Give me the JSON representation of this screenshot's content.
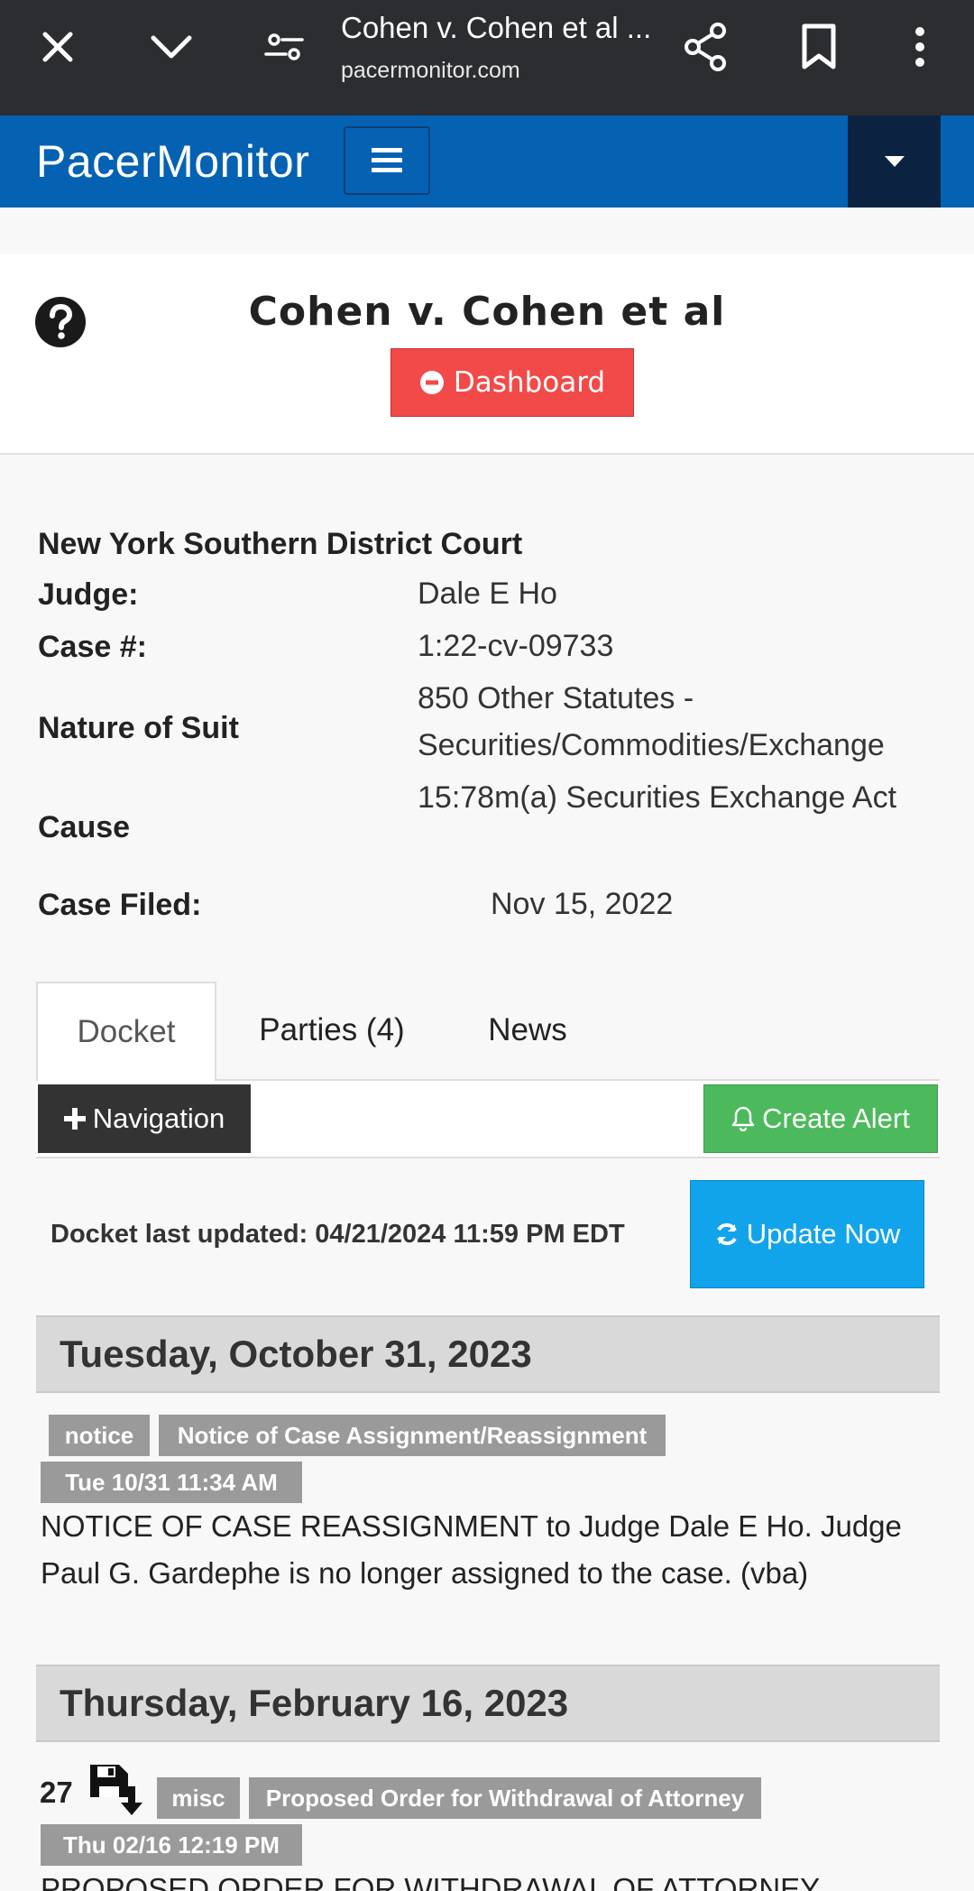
{
  "browser": {
    "page_title": "Cohen v. Cohen et al ...",
    "url": "pacermonitor.com"
  },
  "site": {
    "brand": "PacerMonitor"
  },
  "case": {
    "title": "Cohen v. Cohen et al",
    "dashboard_label": "Dashboard",
    "court": "New York Southern District Court",
    "fields": [
      {
        "label": "Judge:",
        "value": "Dale E Ho"
      },
      {
        "label": "Case #:",
        "value": "1:22-cv-09733"
      },
      {
        "label": "Nature of Suit",
        "value": "850 Other Statutes - Securities/Commodities/Exchange"
      },
      {
        "label": "Cause",
        "value": "15:78m(a) Securities Exchange Act"
      },
      {
        "label": "Case Filed:",
        "value": "Nov 15, 2022"
      }
    ]
  },
  "tabs": [
    {
      "label": "Docket"
    },
    {
      "label": "Parties (4)"
    },
    {
      "label": "News"
    }
  ],
  "toolbar": {
    "navigation_label": "Navigation",
    "create_alert_label": "Create Alert",
    "updated_text": "Docket last updated: 04/21/2024 11:59 PM EDT",
    "update_now_label": "Update Now"
  },
  "docket": [
    {
      "date": "Tuesday, October 31, 2023",
      "entry": {
        "number": "",
        "type": "notice",
        "category": "Notice of Case Assignment/Reassignment",
        "time": "Tue 10/31 11:34 AM",
        "text": "NOTICE OF CASE REASSIGNMENT to Judge Dale E Ho. Judge Paul G. Gardephe is no longer assigned to the case. (vba)"
      }
    },
    {
      "date": "Thursday, February 16, 2023",
      "entry": {
        "number": "27",
        "type": "misc",
        "category": "Proposed Order for Withdrawal of Attorney",
        "time": "Thu 02/16 12:19 PM",
        "text": "PROPOSED ORDER FOR WITHDRAWAL OF ATTORNEY"
      }
    }
  ],
  "colors": {
    "header_blue": "#0562b3",
    "dashboard_red": "#f14a48",
    "alert_green": "#4cb95d",
    "update_blue": "#12a4ea"
  }
}
